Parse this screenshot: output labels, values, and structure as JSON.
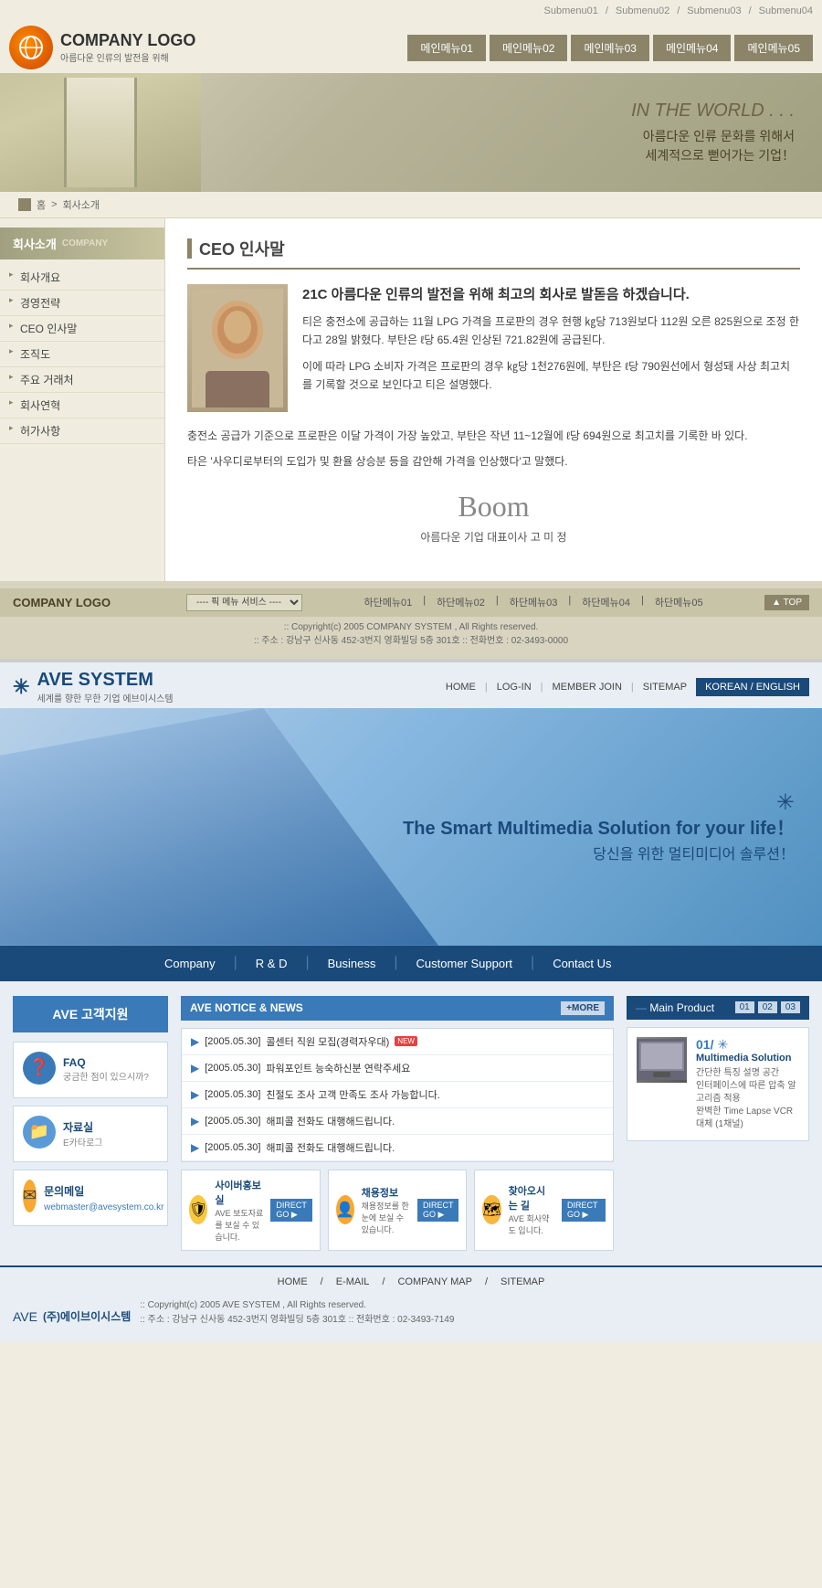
{
  "site1": {
    "topnav": {
      "items": [
        "Submenu01",
        "Submenu02",
        "Submenu03",
        "Submenu04"
      ]
    },
    "logo": {
      "company": "COMPANY LOGO",
      "sub": "아름다운 인류의 발전을 위해"
    },
    "nav": {
      "items": [
        "메인메뉴01",
        "메인메뉴02",
        "메인메뉴03",
        "메인메뉴04",
        "메인메뉴05"
      ]
    },
    "banner": {
      "en": "IN THE WORLD . . .",
      "kr1": "아름다운 인류 문화를 위해서",
      "kr2": "세계적으로 뻗어가는 기업！"
    },
    "breadcrumb": {
      "home": "홈",
      "section": "회사소개"
    },
    "sidebar": {
      "title": "회사소개",
      "title_en": "COMPANY",
      "items": [
        "회사개요",
        "경영전략",
        "CEO 인사말",
        "조직도",
        "주요 거래처",
        "회사연혁",
        "허가사항"
      ]
    },
    "content": {
      "section_title": "CEO 인사말",
      "heading": "21C 아름다운 인류의 발전을 위해  최고의 회사로 발돋음 하겠습니다.",
      "para1": "티은 충전소에 공급하는 11월 LPG 가격을 프로판의 경우 현행 ㎏당 713원보다 112원 오른 825원으로 조정 한다고 28일 밝혔다. 부탄은 ℓ당 65.4원 인상된 721.82원에 공급된다.",
      "para2": "이에 따라 LPG 소비자 가격은 프로판의 경우 ㎏당 1천276원에, 부탄은 ℓ당 790원선에서 형성돼 사상 최고치를 기록할 것으로 보인다고 티은 설명했다.",
      "para3": "충전소 공급가 기준으로 프로판은 이달 가격이 가장 높았고, 부탄은 작년 11~12월에 ℓ당 694원으로 최고치를 기록한 바 있다.",
      "para4": "타은 '사우디로부터의 도입가 및 환율 상승분 등을 감안해 가격을 인상했다'고 말했다.",
      "signature_label": "아름다운 기업  대표이사   고  미  정"
    },
    "footer": {
      "logo": "COMPANY LOGO",
      "select_placeholder": "---- 픽 메뉴 서비스 ----",
      "nav": [
        "하단메뉴01",
        "하단메뉴02",
        "하단메뉴03",
        "하단메뉴04",
        "하단메뉴05"
      ],
      "top_btn": "▲ TOP",
      "copy1": ":: Copyright(c) 2005 COMPANY SYSTEM , All Rights reserved.",
      "copy2": ":: 주소 : 강남구 신사동 452-3번지 영화빌딩 5층 301호   :: 전화번호 : 02-3493-0000"
    }
  },
  "site2": {
    "topnav": {
      "items": [
        "HOME",
        "LOG-IN",
        "MEMBER JOIN",
        "SITEMAP"
      ],
      "lang_btn": "KOREAN / ENGLISH"
    },
    "logo": {
      "star": "✳",
      "company": "AVE SYSTEM",
      "sub": "세계를 향한 무한 기업 에브이시스템"
    },
    "hero": {
      "star": "✳",
      "title": "The Smart Multimedia Solution for your life！",
      "subtitle": "당신을 위한 멀티미디어 솔루션！"
    },
    "nav": {
      "items": [
        "Company",
        "R & D",
        "Business",
        "Customer Support",
        "Contact Us"
      ]
    },
    "sidebar": {
      "title": "AVE 고객지원",
      "items": [
        {
          "icon": "❓",
          "icon_bg": "#3a7ab8",
          "label": "FAQ",
          "desc": "궁금한 점이 있으시까?"
        },
        {
          "icon": "📁",
          "icon_bg": "#5a9ad8",
          "label": "자료실",
          "desc": "E카타로그"
        },
        {
          "icon": "✉",
          "icon_bg": "#f8a830",
          "label": "문의메일",
          "desc": "",
          "email": "webmaster@avesystem.co.kr"
        }
      ]
    },
    "news": {
      "title": "AVE NOTICE & NEWS",
      "more": "+MORE",
      "items": [
        {
          "date": "[2005.05.30]",
          "text": "콜센터 직원 모집(경력자우대)",
          "is_new": true
        },
        {
          "date": "[2005.05.30]",
          "text": "파워포인트 능숙하신분 연락주세요",
          "is_new": false
        },
        {
          "date": "[2005.05.30]",
          "text": "친절도 조사 고객 만족도 조사 가능합니다.",
          "is_new": false
        },
        {
          "date": "[2005.05.30]",
          "text": "해피콜 전화도 대행해드립니다.",
          "is_new": false
        },
        {
          "date": "[2005.05.30]",
          "text": "해피콜 전화도 대행해드립니다.",
          "is_new": false
        }
      ]
    },
    "quicklinks": [
      {
        "icon": "🛡",
        "icon_bg": "#f8c840",
        "label": "사이버홍보실",
        "desc": "AVE 보도자료를 보실 수 있습니다.",
        "btn": "DIRECT GO ▶"
      },
      {
        "icon": "👤",
        "icon_bg": "#f8a830",
        "label": "채용정보",
        "desc": "채용정보를 한눈에 보실 수 있습니다.",
        "btn": "DIRECT GO ▶"
      },
      {
        "icon": "🗺",
        "icon_bg": "#f8b840",
        "label": "찾아오시는 길",
        "desc": "AVE 회사약도 입니다.",
        "btn": "DIRECT GO ▶"
      }
    ],
    "product": {
      "title": "Main Product",
      "nav": [
        "01",
        "02",
        "03"
      ],
      "item": {
        "num": "01/",
        "star": "✳",
        "title": "Multimedia Solution",
        "desc": "간단한 특징 설명 공간\n인터페이스에 따른 압축 알고리즘 적용\n완벽한 Time Lapse VCR 대체 (1채널)"
      }
    },
    "footer": {
      "nav": [
        "HOME",
        "E-MAIL",
        "COMPANY MAP",
        "SITEMAP"
      ],
      "logo_star": "AVE",
      "logo_text": "(주)에이브이시스템",
      "copy1": ":: Copyright(c) 2005 AVE SYSTEM , All Rights reserved.",
      "copy2": ":: 주소 : 강남구 신사동 452-3번지 영화빌딩 5층 301호   :: 전화번호 : 02-3493-7149"
    }
  }
}
